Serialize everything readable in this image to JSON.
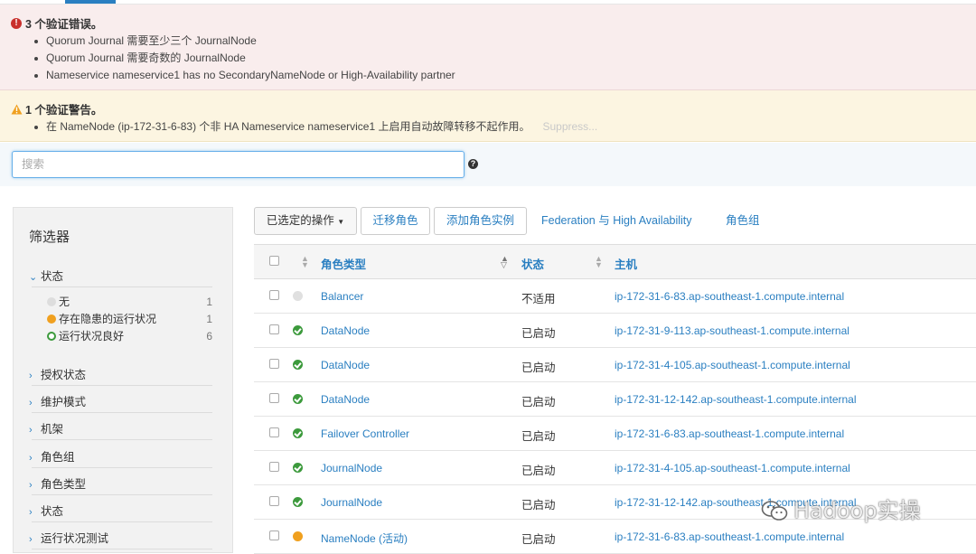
{
  "errors": {
    "title": "3 个验证错误。",
    "items": [
      "Quorum Journal 需要至少三个 JournalNode",
      "Quorum Journal 需要奇数的 JournalNode",
      "Nameservice nameservice1 has no SecondaryNameNode or High-Availability partner"
    ]
  },
  "warnings": {
    "title": "1 个验证警告。",
    "items": [
      "在 NameNode (ip-172-31-6-83) 个非 HA Nameservice nameservice1 上启用自动故障转移不起作用。"
    ],
    "suppress": "Suppress..."
  },
  "search": {
    "placeholder": "搜索"
  },
  "filters": {
    "title": "筛选器",
    "status_section": "状态",
    "status_items": [
      {
        "label": "无",
        "count": "1"
      },
      {
        "label": "存在隐患的运行状况",
        "count": "1"
      },
      {
        "label": "运行状况良好",
        "count": "6"
      }
    ],
    "sections": [
      "授权状态",
      "维护模式",
      "机架",
      "角色组",
      "角色类型",
      "状态",
      "运行状况测试"
    ]
  },
  "toolbar": {
    "selected_actions": "已选定的操作",
    "migrate_roles": "迁移角色",
    "add_role_instances": "添加角色实例",
    "federation_ha": "Federation 与 High Availability",
    "role_groups": "角色组"
  },
  "table": {
    "headers": {
      "role_type": "角色类型",
      "status": "状态",
      "host": "主机"
    },
    "rows": [
      {
        "health": "none",
        "role": "Balancer",
        "status": "不适用",
        "host": "ip-172-31-6-83.ap-southeast-1.compute.internal"
      },
      {
        "health": "ok",
        "role": "DataNode",
        "status": "已启动",
        "host": "ip-172-31-9-113.ap-southeast-1.compute.internal"
      },
      {
        "health": "ok",
        "role": "DataNode",
        "status": "已启动",
        "host": "ip-172-31-4-105.ap-southeast-1.compute.internal"
      },
      {
        "health": "ok",
        "role": "DataNode",
        "status": "已启动",
        "host": "ip-172-31-12-142.ap-southeast-1.compute.internal"
      },
      {
        "health": "ok",
        "role": "Failover Controller",
        "status": "已启动",
        "host": "ip-172-31-6-83.ap-southeast-1.compute.internal"
      },
      {
        "health": "ok",
        "role": "JournalNode",
        "status": "已启动",
        "host": "ip-172-31-4-105.ap-southeast-1.compute.internal"
      },
      {
        "health": "ok",
        "role": "JournalNode",
        "status": "已启动",
        "host": "ip-172-31-12-142.ap-southeast-1.compute.internal"
      },
      {
        "health": "warn",
        "role": "NameNode (活动)",
        "status": "已启动",
        "host": "ip-172-31-6-83.ap-southeast-1.compute.internal"
      }
    ]
  },
  "watermark": "Hadoop实操",
  "colors": {
    "link": "#2a7fc1",
    "error": "#c9302c",
    "warning": "#f0a01f",
    "ok": "#3c9a3c"
  }
}
